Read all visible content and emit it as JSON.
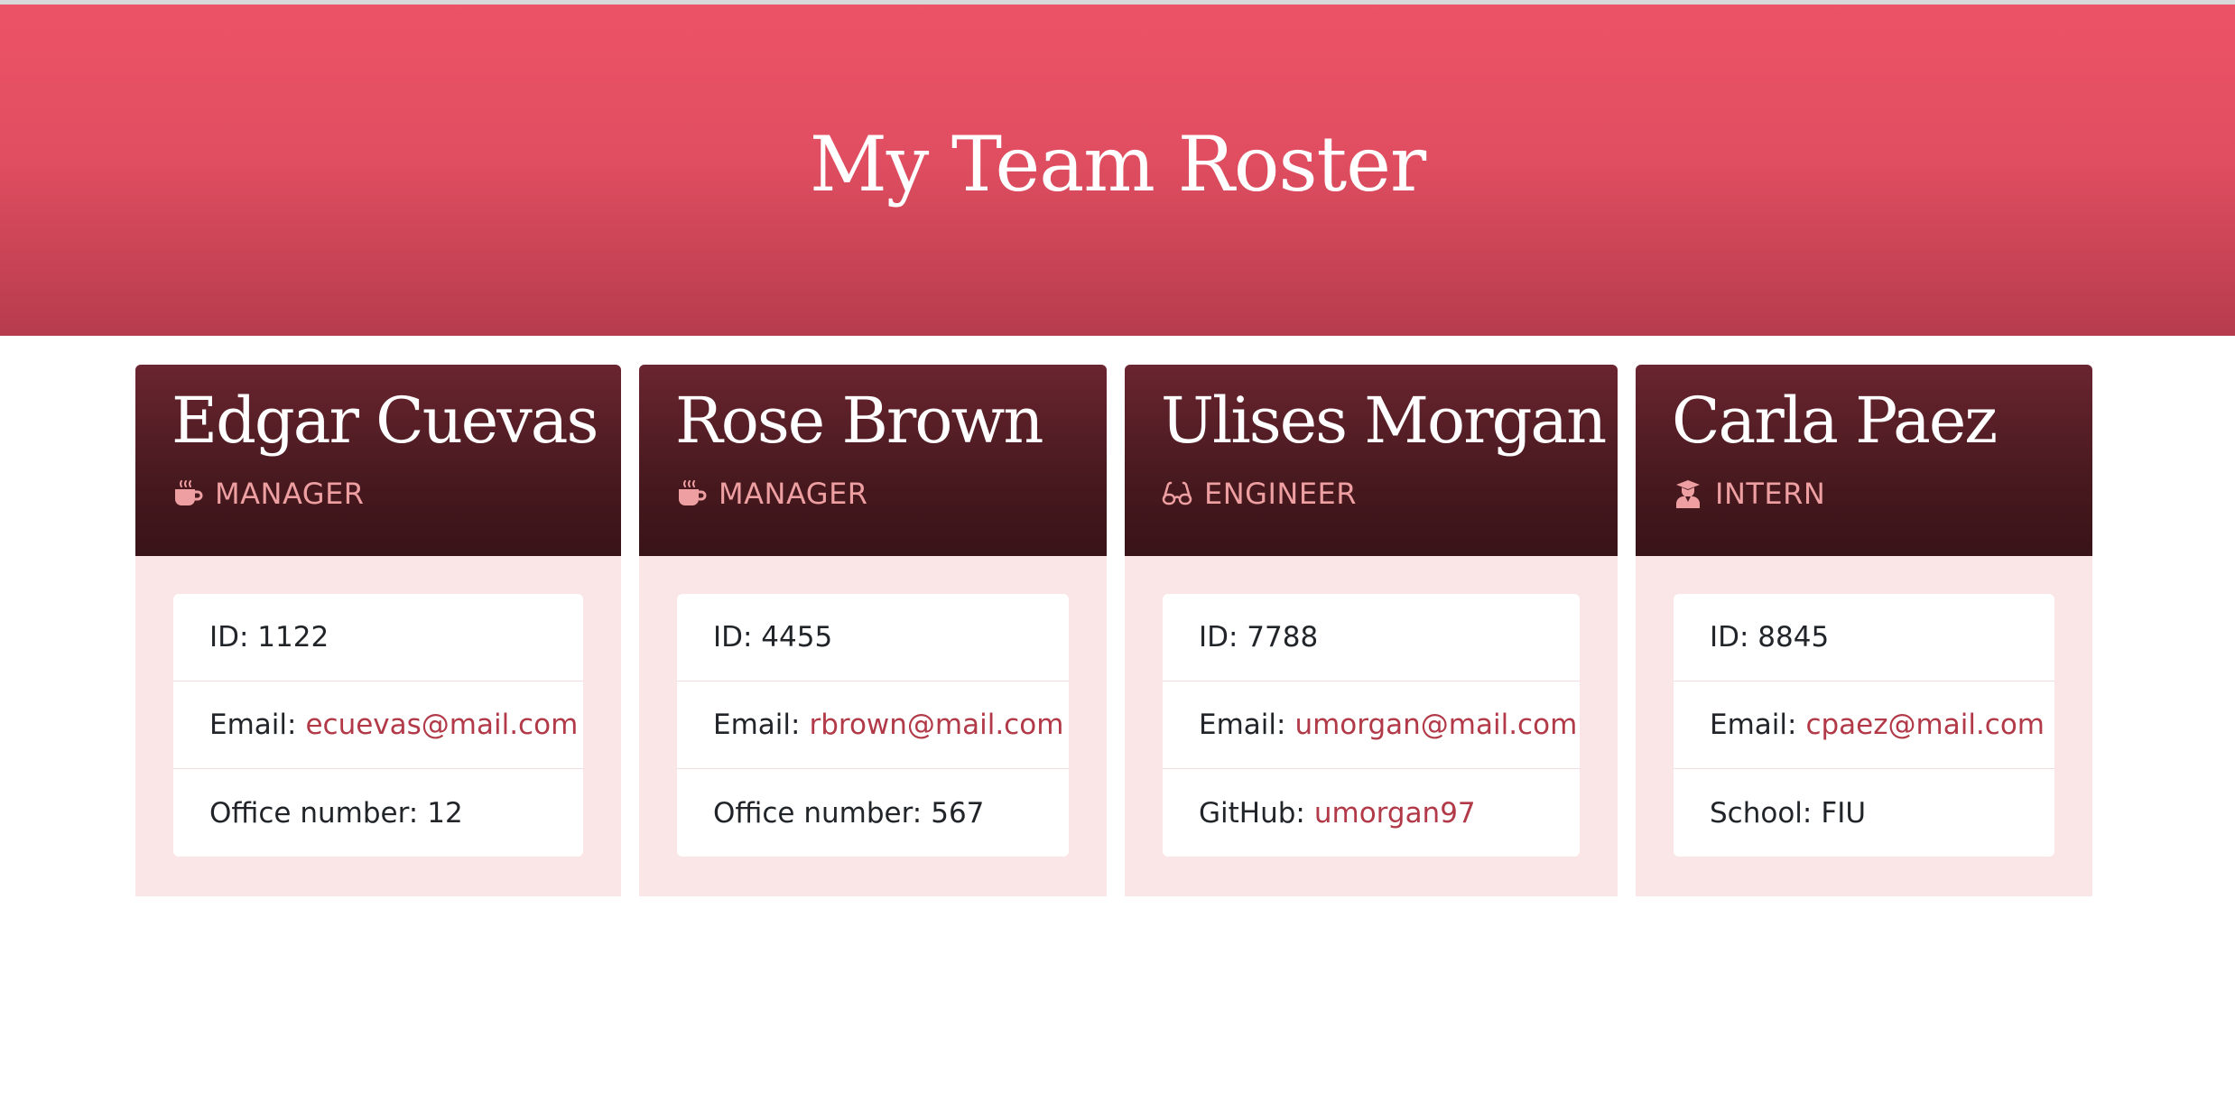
{
  "header": {
    "title": "My Team Roster"
  },
  "employees": [
    {
      "name": "Edgar Cuevas",
      "role": "MANAGER",
      "role_icon": "coffee-icon",
      "id_text": "ID: 1122",
      "email_label": "Email:",
      "email": "ecuevas@mail.com",
      "extra_label": "Office number:",
      "extra_value": "12"
    },
    {
      "name": "Rose Brown",
      "role": "MANAGER",
      "role_icon": "coffee-icon",
      "id_text": "ID: 4455",
      "email_label": "Email:",
      "email": "rbrown@mail.com",
      "extra_label": "Office number:",
      "extra_value": "567"
    },
    {
      "name": "Ulises Morgan",
      "role": "ENGINEER",
      "role_icon": "glasses-icon",
      "id_text": "ID: 7788",
      "email_label": "Email:",
      "email": "umorgan@mail.com",
      "extra_label": "GitHub:",
      "extra_value": "umorgan97"
    },
    {
      "name": "Carla Paez",
      "role": "INTERN",
      "role_icon": "graduate-icon",
      "id_text": "ID: 8845",
      "email_label": "Email:",
      "email": "cpaez@mail.com",
      "extra_label": "School:",
      "extra_value": "FIU"
    }
  ],
  "colors": {
    "hero_top": "#ed5266",
    "hero_bottom": "#b63c4d",
    "card_header": "#4a1a20",
    "card_body": "#fbe6e7",
    "role_text": "#ee9fa1",
    "link": "#b23a48"
  }
}
